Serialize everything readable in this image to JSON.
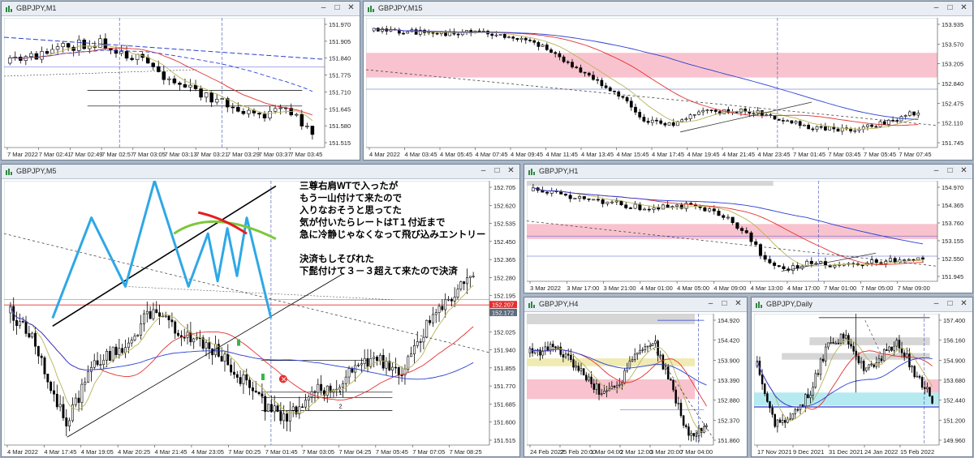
{
  "windows": [
    {
      "key": "m1",
      "title": "GBPJPY,M1",
      "prices": [
        "151.970",
        "151.905",
        "151.840",
        "151.775",
        "151.710",
        "151.645",
        "151.580",
        "151.515"
      ],
      "times": [
        "7 Mar 2022",
        "7 Mar 02:41",
        "7 Mar 02:49",
        "7 Mar 02:57",
        "7 Mar 03:05",
        "7 Mar 03:13",
        "7 Mar 03:21",
        "7 Mar 03:29",
        "7 Mar 03:37",
        "7 Mar 03:45"
      ]
    },
    {
      "key": "m15",
      "title": "GBPJPY,M15",
      "prices": [
        "153.935",
        "153.570",
        "153.205",
        "152.840",
        "152.475",
        "152.110",
        "151.745"
      ],
      "times": [
        "4 Mar 2022",
        "4 Mar 03:45",
        "4 Mar 05:45",
        "4 Mar 07:45",
        "4 Mar 09:45",
        "4 Mar 11:45",
        "4 Mar 13:45",
        "4 Mar 15:45",
        "4 Mar 17:45",
        "4 Mar 19:45",
        "4 Mar 21:45",
        "4 Mar 23:45",
        "7 Mar 01:45",
        "7 Mar 03:45",
        "7 Mar 05:45",
        "7 Mar 07:45"
      ]
    },
    {
      "key": "m5",
      "title": "GBPJPY,M5",
      "prices": [
        "152.705",
        "152.620",
        "152.535",
        "152.450",
        "152.365",
        "152.280",
        "152.195",
        "152.110",
        "152.025",
        "151.940",
        "151.855",
        "151.770",
        "151.685",
        "151.600",
        "151.515"
      ],
      "price_tags": [
        "152.207",
        "152.172"
      ],
      "times": [
        "4 Mar 2022",
        "4 Mar 17:45",
        "4 Mar 19:05",
        "4 Mar 20:25",
        "4 Mar 21:45",
        "4 Mar 23:05",
        "7 Mar 00:25",
        "7 Mar 01:45",
        "7 Mar 03:05",
        "7 Mar 04:25",
        "7 Mar 05:45",
        "7 Mar 07:05",
        "7 Mar 08:25"
      ]
    },
    {
      "key": "h1",
      "title": "GBPJPY,H1",
      "prices": [
        "154.970",
        "154.365",
        "153.760",
        "153.155",
        "152.550",
        "151.945"
      ],
      "times": [
        "3 Mar 2022",
        "3 Mar 17:00",
        "3 Mar 21:00",
        "4 Mar 01:00",
        "4 Mar 05:00",
        "4 Mar 09:00",
        "4 Mar 13:00",
        "4 Mar 17:00",
        "7 Mar 01:00",
        "7 Mar 05:00",
        "7 Mar 09:00"
      ]
    },
    {
      "key": "h4",
      "title": "GBPJPY,H4",
      "prices": [
        "154.920",
        "154.420",
        "153.900",
        "153.390",
        "152.880",
        "152.370",
        "151.860"
      ],
      "times": [
        "24 Feb 2022",
        "25 Feb 20:00",
        "1 Mar 04:00",
        "2 Mar 12:00",
        "3 Mar 20:00",
        "7 Mar 04:00"
      ]
    },
    {
      "key": "d1",
      "title": "GBPJPY,Daily",
      "prices": [
        "157.400",
        "156.160",
        "154.900",
        "153.680",
        "152.440",
        "151.200",
        "149.960"
      ],
      "times": [
        "17 Nov 2021",
        "9 Dec 2021",
        "31 Dec 2021",
        "24 Jan 2022",
        "15 Feb 2022"
      ]
    }
  ],
  "annotation": {
    "lines": [
      "三尊右肩WTで入ったが",
      "もう一山付けて来たので",
      "入りなおそうと思ってた",
      "気が付いたらレートはT１付近まで",
      "急に冷静じゃなくなって飛び込みエントリー",
      "",
      "決済もしそびれた",
      "下髭付けて３－３超えて来たので決済"
    ]
  },
  "labels": {
    "tp1": "1",
    "tp2": "2",
    "tp3": "3"
  },
  "colors": {
    "up": "#ffffff",
    "down": "#000000",
    "ma_red": "#e53030",
    "ma_blue": "#2a3fd4",
    "ma_olive": "#b9b35a",
    "zone_pink": "#f7b9c6",
    "zone_gray": "#cfcfcf",
    "zone_yellow": "#ece7a6",
    "zone_cyan": "#a8e6ee",
    "zigzag": "#2ea8e6"
  }
}
